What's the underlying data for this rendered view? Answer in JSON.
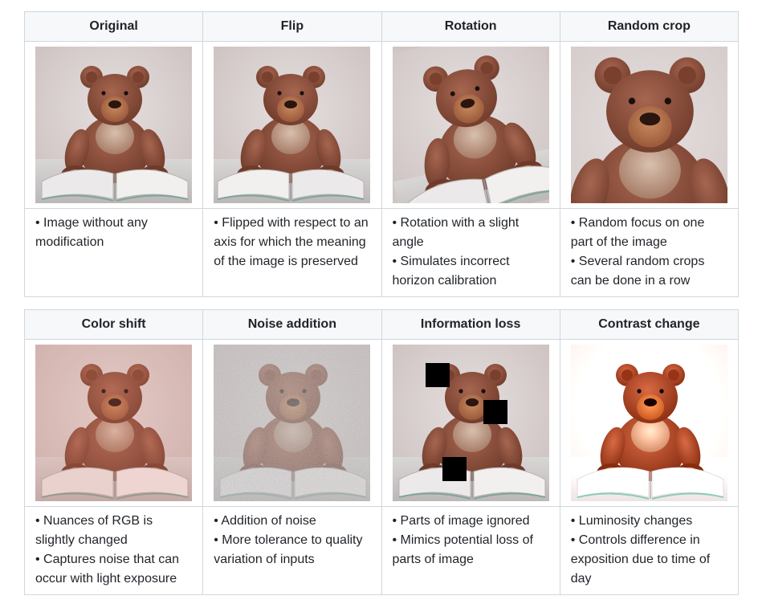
{
  "top_table": {
    "columns": [
      {
        "header": "Original",
        "icon": "teddy-bear-image",
        "bullets": [
          "• Image without any modification"
        ]
      },
      {
        "header": "Flip",
        "icon": "teddy-bear-image-flipped",
        "bullets": [
          "• Flipped with respect to an axis for which the meaning of the image is preserved"
        ]
      },
      {
        "header": "Rotation",
        "icon": "teddy-bear-image-rotated",
        "bullets": [
          "• Rotation with a slight angle",
          "• Simulates incorrect horizon calibration"
        ]
      },
      {
        "header": "Random crop",
        "icon": "teddy-bear-image-cropped",
        "bullets": [
          "• Random focus on one part of the image",
          "• Several random crops can be done in a row"
        ]
      }
    ]
  },
  "bottom_table": {
    "columns": [
      {
        "header": "Color shift",
        "icon": "teddy-bear-image-color-shift",
        "bullets": [
          "• Nuances of RGB is slightly changed",
          "• Captures noise that can occur with light exposure"
        ]
      },
      {
        "header": "Noise addition",
        "icon": "teddy-bear-image-noise",
        "bullets": [
          "• Addition of noise",
          "• More tolerance to quality variation of inputs"
        ]
      },
      {
        "header": "Information loss",
        "icon": "teddy-bear-image-occluded",
        "bullets": [
          "• Parts of image ignored",
          "• Mimics potential loss of parts of image"
        ]
      },
      {
        "header": "Contrast change",
        "icon": "teddy-bear-image-contrast",
        "bullets": [
          "• Luminosity changes",
          "• Controls difference in exposition due to time of day"
        ]
      }
    ]
  },
  "colors": {
    "border": "#d0d7de",
    "header_bg": "#f6f8fa",
    "bear_fur": "#8a4e3a",
    "book_pages": "#ece9ea",
    "background_wall": "#dcd4d3"
  }
}
